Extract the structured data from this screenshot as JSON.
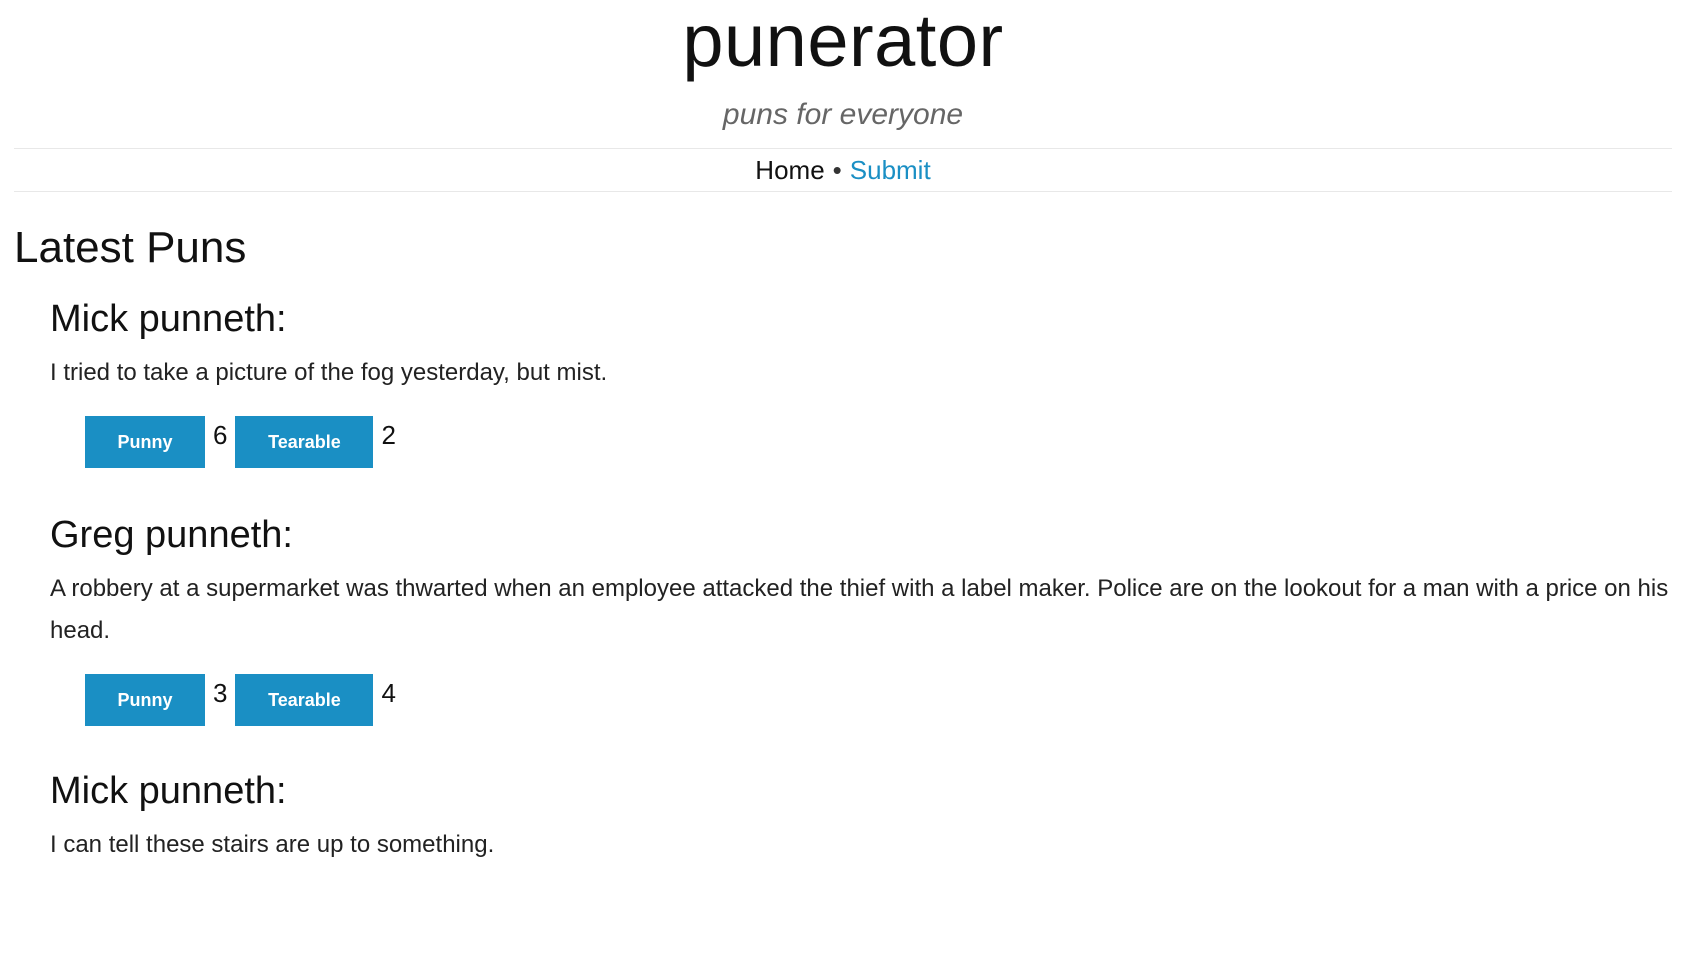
{
  "site": {
    "title": "punerator",
    "tagline": "puns for everyone"
  },
  "nav": {
    "home_label": "Home",
    "separator": "•",
    "submit_label": "Submit"
  },
  "section": {
    "title": "Latest Puns"
  },
  "puns": [
    {
      "author_line": "Mick punneth:",
      "text": "I tried to take a picture of the fog yesterday, but mist.",
      "punny_label": "Punny",
      "punny_count": "6",
      "tearable_label": "Tearable",
      "tearable_count": "2"
    },
    {
      "author_line": "Greg punneth:",
      "text": "A robbery at a supermarket was thwarted when an employee attacked the thief with a label maker. Police are on the lookout for a man with a price on his head.",
      "punny_label": "Punny",
      "punny_count": "3",
      "tearable_label": "Tearable",
      "tearable_count": "4"
    },
    {
      "author_line": "Mick punneth:",
      "text": "I can tell these stairs are up to something."
    }
  ],
  "colors": {
    "accent": "#1a8fc4",
    "link": "#1a8fc4",
    "text": "#222222",
    "tagline": "#666666"
  }
}
